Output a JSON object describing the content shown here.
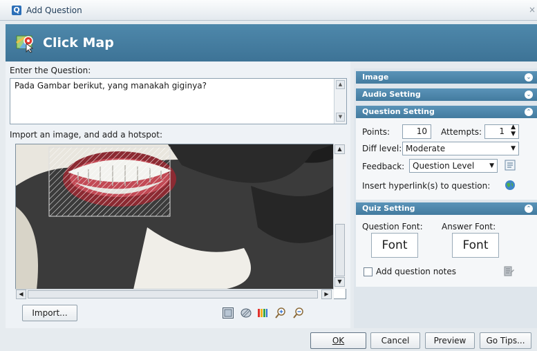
{
  "window": {
    "title": "Add Question",
    "close_glyph": "×",
    "app_icon_letter": "Q"
  },
  "header": {
    "title": "Click Map"
  },
  "left": {
    "question_label": "Enter the Question:",
    "question_text": "Pada Gambar berikut, yang manakah giginya?",
    "image_label": "Import an image, and add a hotspot:",
    "import_button": "Import...",
    "tools": [
      "rectangle-hotspot-icon",
      "ellipse-hotspot-icon",
      "color-palette-icon",
      "zoom-in-icon",
      "zoom-out-icon"
    ]
  },
  "right": {
    "image_section": "Image",
    "audio_section": "Audio Setting",
    "question_section": "Question Setting",
    "points_label": "Points:",
    "points_value": "10",
    "attempts_label": "Attempts:",
    "attempts_value": "1",
    "diff_label": "Diff level:",
    "diff_value": "Moderate",
    "feedback_label": "Feedback:",
    "feedback_value": "Question Level",
    "hyperlink_label": "Insert hyperlink(s) to question:",
    "quiz_section": "Quiz Setting",
    "question_font_label": "Question Font:",
    "answer_font_label": "Answer Font:",
    "question_font_button": "Font",
    "answer_font_button": "Font",
    "notes_label": "Add question notes"
  },
  "buttons": {
    "ok": "OK",
    "cancel": "Cancel",
    "preview": "Preview",
    "go_tips": "Go Tips..."
  },
  "colors": {
    "header_blue": "#4680a3",
    "section_blue": "#4f88ad",
    "hotspot": "#ffffff"
  }
}
